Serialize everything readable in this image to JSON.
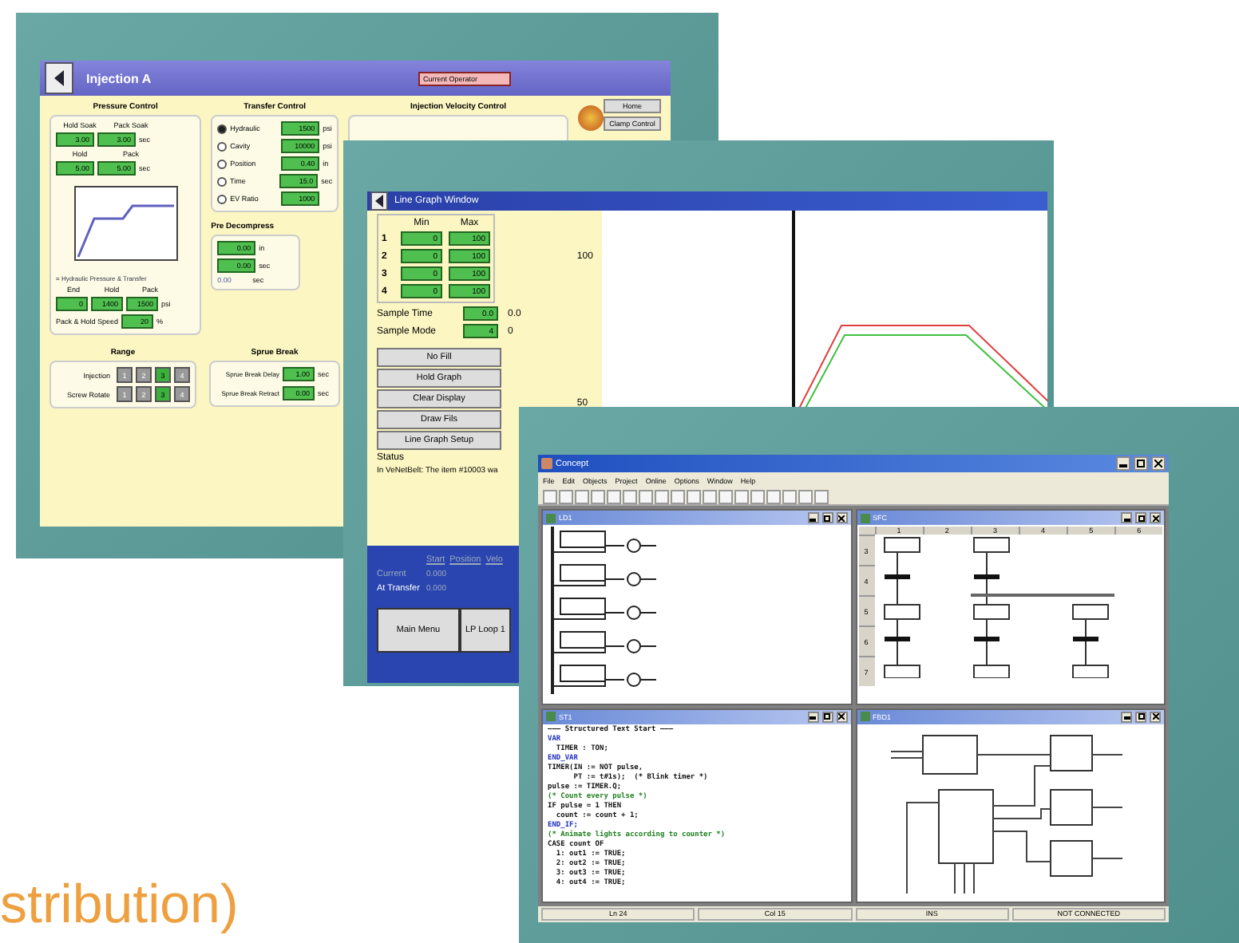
{
  "injection_screen": {
    "title": "Injection A",
    "operator_label": "Current Operator",
    "side_buttons": [
      "Home",
      "Clamp Control"
    ],
    "pressure_control": {
      "title": "Pressure Control",
      "soak_labels": [
        "Hold Soak",
        "Pack Soak"
      ],
      "soak_values": [
        "3.00",
        "3.00"
      ],
      "soak_unit": "sec",
      "pressure_labels": [
        "Hold",
        "Pack"
      ],
      "pressure_values": [
        "5.00",
        "5.00"
      ],
      "pressure_unit": "sec",
      "legend": "= Hydraulic Pressure & Transfer",
      "end_labels": [
        "End",
        "Hold",
        "Pack"
      ],
      "end_values": [
        "0",
        "1400",
        "1500"
      ],
      "end_unit": "psi",
      "speed_label": "Pack & Hold Speed",
      "speed_value": "20",
      "speed_unit": "%"
    },
    "transfer_control": {
      "title": "Transfer Control",
      "items": [
        {
          "label": "Hydraulic",
          "selected": true,
          "value": "1500",
          "unit": "psi"
        },
        {
          "label": "Cavity",
          "selected": false,
          "value": "10000",
          "unit": "psi"
        },
        {
          "label": "Position",
          "selected": false,
          "value": "0.40",
          "unit": "in"
        },
        {
          "label": "Time",
          "selected": false,
          "value": "15.0",
          "unit": "sec"
        },
        {
          "label": "EV Ratio",
          "selected": false,
          "value": "1000"
        }
      ]
    },
    "velocity_title": "Injection Velocity Control",
    "pre_decompress": {
      "title": "Pre Decompress",
      "values": [
        "0.00",
        "0.00"
      ],
      "units": [
        "in",
        "sec"
      ],
      "reading": "0.00",
      "reading_unit": "sec"
    },
    "range": {
      "title": "Range",
      "rows": [
        {
          "label": "Injection",
          "options": [
            {
              "label": "1",
              "selected": false
            },
            {
              "label": "2",
              "selected": false
            },
            {
              "label": "3",
              "selected": true
            },
            {
              "label": "4",
              "selected": false
            }
          ]
        },
        {
          "label": "Screw Rotate",
          "options": [
            {
              "label": "1",
              "selected": false
            },
            {
              "label": "2",
              "selected": false
            },
            {
              "label": "3",
              "selected": true
            },
            {
              "label": "4",
              "selected": false
            }
          ]
        }
      ]
    },
    "sprue_break": {
      "title": "Sprue Break",
      "rows": [
        {
          "label": "Sprue Break Delay",
          "value": "1.00",
          "unit": "sec"
        },
        {
          "label": "Sprue Break Retract",
          "value": "0.00",
          "unit": "sec"
        }
      ]
    }
  },
  "line_graph_window": {
    "title": "Line Graph Window",
    "limit_headers": [
      "Min",
      "Max"
    ],
    "limits": [
      {
        "index": "1",
        "min": "0",
        "max": "100"
      },
      {
        "index": "2",
        "min": "0",
        "max": "100"
      },
      {
        "index": "3",
        "min": "0",
        "max": "100"
      },
      {
        "index": "4",
        "min": "0",
        "max": "100"
      }
    ],
    "samples": [
      {
        "label": "Sample Time",
        "value": "0.0",
        "reading": "0.0"
      },
      {
        "label": "Sample Mode",
        "value": "4",
        "reading": "0"
      }
    ],
    "buttons": [
      "No Fill",
      "Hold Graph",
      "Clear Display",
      "Draw Fils",
      "Line Graph Setup"
    ],
    "status_label": "Status",
    "status_text": "In VeNetBelt: The item #10003 wa",
    "axis_labels": [
      "100",
      "50"
    ],
    "motion_headers": [
      "Start",
      "Position",
      "Velo"
    ],
    "motion_rows": [
      {
        "label": "Current",
        "value": "0.000"
      },
      {
        "label": "At Transfer",
        "value": "0.000"
      }
    ],
    "nav_buttons": [
      "Main Menu",
      "LP Loop 1"
    ]
  },
  "concept_window": {
    "title": "Concept",
    "menu": [
      "File",
      "Edit",
      "Objects",
      "Project",
      "Online",
      "Options",
      "Window",
      "Help"
    ],
    "children": [
      {
        "kind": "ladder",
        "title": "LD1"
      },
      {
        "kind": "sfc",
        "title": "SFC",
        "columns": [
          "1",
          "2",
          "3",
          "4",
          "5",
          "6"
        ],
        "rows": [
          "3",
          "4",
          "5",
          "6",
          "7"
        ]
      },
      {
        "kind": "st",
        "title": "ST1",
        "lines": [
          {
            "kind": "heading",
            "text": "——— Structured Text Start ———"
          },
          {
            "kind": "keyword",
            "text": "VAR"
          },
          {
            "kind": "code",
            "text": "  TIMER : TON;"
          },
          {
            "kind": "keyword",
            "text": "END_VAR"
          },
          {
            "kind": "code",
            "text": "TIMER(IN := NOT pulse,"
          },
          {
            "kind": "code",
            "text": "      PT := t#1s);  (* Blink timer *)"
          },
          {
            "kind": "code",
            "text": "pulse := TIMER.Q;"
          },
          {
            "kind": "comment",
            "text": "(* Count every pulse *)"
          },
          {
            "kind": "code",
            "text": "IF pulse = 1 THEN"
          },
          {
            "kind": "code",
            "text": "  count := count + 1;"
          },
          {
            "kind": "keyword",
            "text": "END_IF;"
          },
          {
            "kind": "comment",
            "text": "(* Animate lights according to counter *)"
          },
          {
            "kind": "code",
            "text": "CASE count OF"
          },
          {
            "kind": "code",
            "text": "  1: out1 := TRUE;"
          },
          {
            "kind": "code",
            "text": "  2: out2 := TRUE;"
          },
          {
            "kind": "code",
            "text": "  3: out3 := TRUE;"
          },
          {
            "kind": "code",
            "text": "  4: out4 := TRUE;"
          }
        ]
      },
      {
        "kind": "fbd",
        "title": "FBD1"
      }
    ],
    "status_bar": [
      "Ln 24",
      "Col 15",
      "INS",
      "NOT CONNECTED"
    ]
  },
  "caption": "stribution)"
}
